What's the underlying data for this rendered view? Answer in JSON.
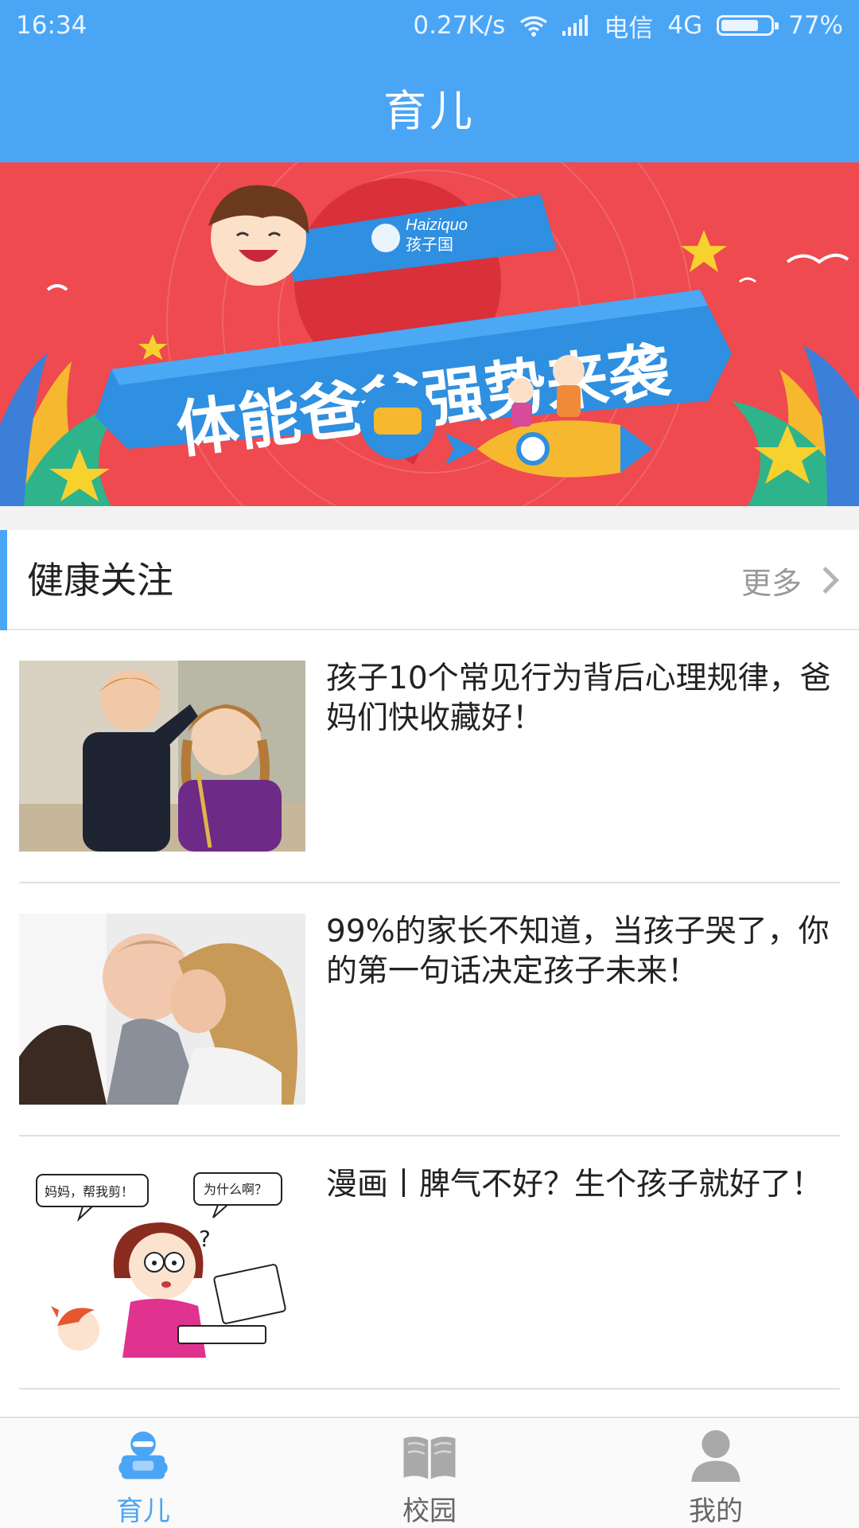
{
  "status_bar": {
    "time": "16:34",
    "net_speed": "0.27K/s",
    "carrier": "电信",
    "network": "4G",
    "battery": "77%",
    "battery_level": 0.77,
    "icons": [
      "wifi-icon",
      "signal-icon",
      "battery-icon"
    ]
  },
  "header": {
    "title": "育儿"
  },
  "banner": {
    "headline": "体能爸爸强势来袭",
    "brand_en": "Haiziquo",
    "brand_cn": "孩子国"
  },
  "section": {
    "title": "健康关注",
    "more_label": "更多"
  },
  "articles": [
    {
      "title": "孩子10个常见行为背后心理规律，爸妈们快收藏好！",
      "thumb": "kids-classroom-photo"
    },
    {
      "title": "99%的家长不知道，当孩子哭了，你的第一句话决定孩子未来！",
      "thumb": "mother-comforting-child-photo"
    },
    {
      "title": "漫画丨脾气不好？生个孩子就好了！",
      "thumb": "comic-mother-child-illustration",
      "comic_bubbles": [
        "妈妈，帮我剪！",
        "为什么啊？"
      ]
    }
  ],
  "bottom_nav": {
    "items": [
      {
        "label": "育儿",
        "icon": "parenting-icon",
        "active": true
      },
      {
        "label": "校园",
        "icon": "book-icon",
        "active": false
      },
      {
        "label": "我的",
        "icon": "user-icon",
        "active": false
      }
    ]
  },
  "colors": {
    "primary": "#4aa5f5",
    "banner_red": "#ee4a4f",
    "banner_blue": "#2f8fe0",
    "text": "#222222",
    "muted": "#999999"
  }
}
